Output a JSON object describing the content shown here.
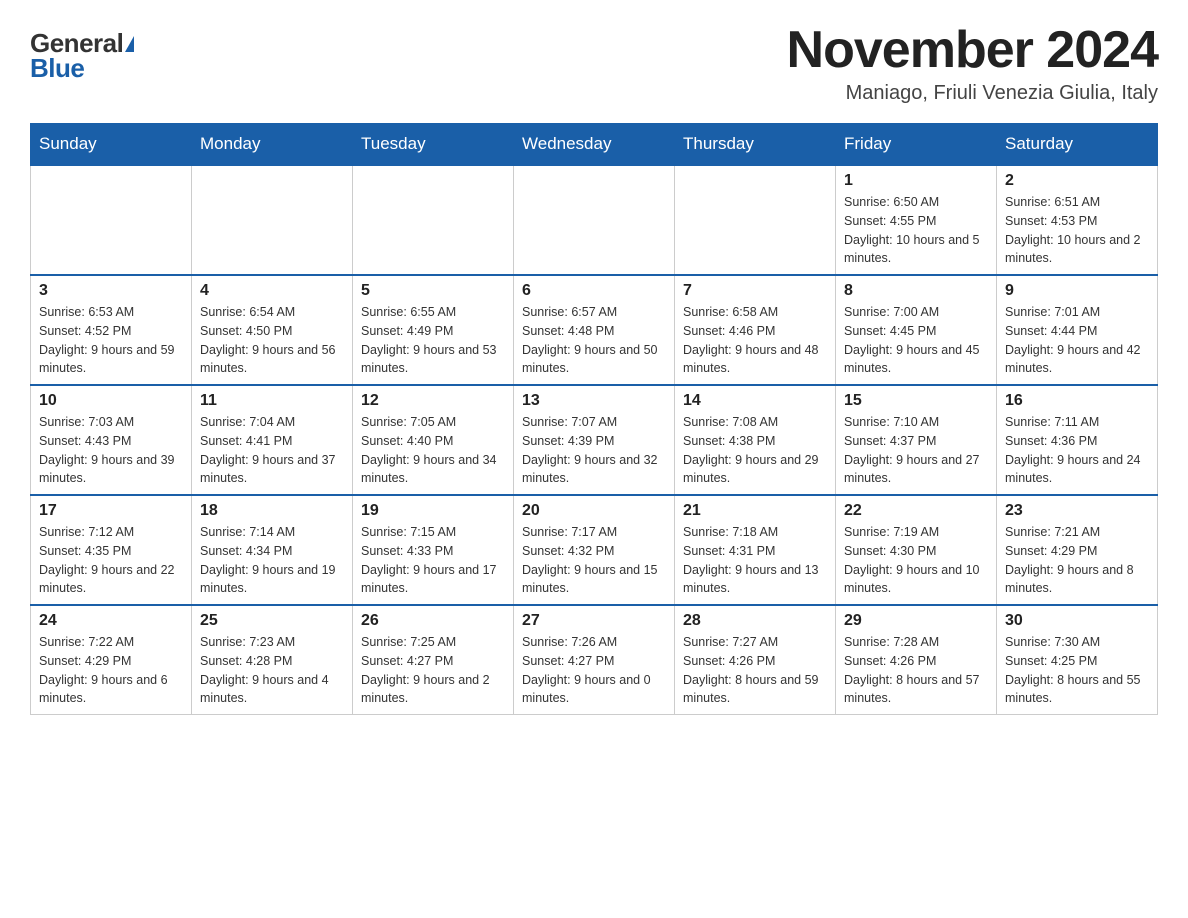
{
  "header": {
    "logo_general": "General",
    "logo_blue": "Blue",
    "title": "November 2024",
    "location": "Maniago, Friuli Venezia Giulia, Italy"
  },
  "days_of_week": [
    "Sunday",
    "Monday",
    "Tuesday",
    "Wednesday",
    "Thursday",
    "Friday",
    "Saturday"
  ],
  "weeks": [
    [
      {
        "day": "",
        "info": ""
      },
      {
        "day": "",
        "info": ""
      },
      {
        "day": "",
        "info": ""
      },
      {
        "day": "",
        "info": ""
      },
      {
        "day": "",
        "info": ""
      },
      {
        "day": "1",
        "info": "Sunrise: 6:50 AM\nSunset: 4:55 PM\nDaylight: 10 hours and 5 minutes."
      },
      {
        "day": "2",
        "info": "Sunrise: 6:51 AM\nSunset: 4:53 PM\nDaylight: 10 hours and 2 minutes."
      }
    ],
    [
      {
        "day": "3",
        "info": "Sunrise: 6:53 AM\nSunset: 4:52 PM\nDaylight: 9 hours and 59 minutes."
      },
      {
        "day": "4",
        "info": "Sunrise: 6:54 AM\nSunset: 4:50 PM\nDaylight: 9 hours and 56 minutes."
      },
      {
        "day": "5",
        "info": "Sunrise: 6:55 AM\nSunset: 4:49 PM\nDaylight: 9 hours and 53 minutes."
      },
      {
        "day": "6",
        "info": "Sunrise: 6:57 AM\nSunset: 4:48 PM\nDaylight: 9 hours and 50 minutes."
      },
      {
        "day": "7",
        "info": "Sunrise: 6:58 AM\nSunset: 4:46 PM\nDaylight: 9 hours and 48 minutes."
      },
      {
        "day": "8",
        "info": "Sunrise: 7:00 AM\nSunset: 4:45 PM\nDaylight: 9 hours and 45 minutes."
      },
      {
        "day": "9",
        "info": "Sunrise: 7:01 AM\nSunset: 4:44 PM\nDaylight: 9 hours and 42 minutes."
      }
    ],
    [
      {
        "day": "10",
        "info": "Sunrise: 7:03 AM\nSunset: 4:43 PM\nDaylight: 9 hours and 39 minutes."
      },
      {
        "day": "11",
        "info": "Sunrise: 7:04 AM\nSunset: 4:41 PM\nDaylight: 9 hours and 37 minutes."
      },
      {
        "day": "12",
        "info": "Sunrise: 7:05 AM\nSunset: 4:40 PM\nDaylight: 9 hours and 34 minutes."
      },
      {
        "day": "13",
        "info": "Sunrise: 7:07 AM\nSunset: 4:39 PM\nDaylight: 9 hours and 32 minutes."
      },
      {
        "day": "14",
        "info": "Sunrise: 7:08 AM\nSunset: 4:38 PM\nDaylight: 9 hours and 29 minutes."
      },
      {
        "day": "15",
        "info": "Sunrise: 7:10 AM\nSunset: 4:37 PM\nDaylight: 9 hours and 27 minutes."
      },
      {
        "day": "16",
        "info": "Sunrise: 7:11 AM\nSunset: 4:36 PM\nDaylight: 9 hours and 24 minutes."
      }
    ],
    [
      {
        "day": "17",
        "info": "Sunrise: 7:12 AM\nSunset: 4:35 PM\nDaylight: 9 hours and 22 minutes."
      },
      {
        "day": "18",
        "info": "Sunrise: 7:14 AM\nSunset: 4:34 PM\nDaylight: 9 hours and 19 minutes."
      },
      {
        "day": "19",
        "info": "Sunrise: 7:15 AM\nSunset: 4:33 PM\nDaylight: 9 hours and 17 minutes."
      },
      {
        "day": "20",
        "info": "Sunrise: 7:17 AM\nSunset: 4:32 PM\nDaylight: 9 hours and 15 minutes."
      },
      {
        "day": "21",
        "info": "Sunrise: 7:18 AM\nSunset: 4:31 PM\nDaylight: 9 hours and 13 minutes."
      },
      {
        "day": "22",
        "info": "Sunrise: 7:19 AM\nSunset: 4:30 PM\nDaylight: 9 hours and 10 minutes."
      },
      {
        "day": "23",
        "info": "Sunrise: 7:21 AM\nSunset: 4:29 PM\nDaylight: 9 hours and 8 minutes."
      }
    ],
    [
      {
        "day": "24",
        "info": "Sunrise: 7:22 AM\nSunset: 4:29 PM\nDaylight: 9 hours and 6 minutes."
      },
      {
        "day": "25",
        "info": "Sunrise: 7:23 AM\nSunset: 4:28 PM\nDaylight: 9 hours and 4 minutes."
      },
      {
        "day": "26",
        "info": "Sunrise: 7:25 AM\nSunset: 4:27 PM\nDaylight: 9 hours and 2 minutes."
      },
      {
        "day": "27",
        "info": "Sunrise: 7:26 AM\nSunset: 4:27 PM\nDaylight: 9 hours and 0 minutes."
      },
      {
        "day": "28",
        "info": "Sunrise: 7:27 AM\nSunset: 4:26 PM\nDaylight: 8 hours and 59 minutes."
      },
      {
        "day": "29",
        "info": "Sunrise: 7:28 AM\nSunset: 4:26 PM\nDaylight: 8 hours and 57 minutes."
      },
      {
        "day": "30",
        "info": "Sunrise: 7:30 AM\nSunset: 4:25 PM\nDaylight: 8 hours and 55 minutes."
      }
    ]
  ]
}
